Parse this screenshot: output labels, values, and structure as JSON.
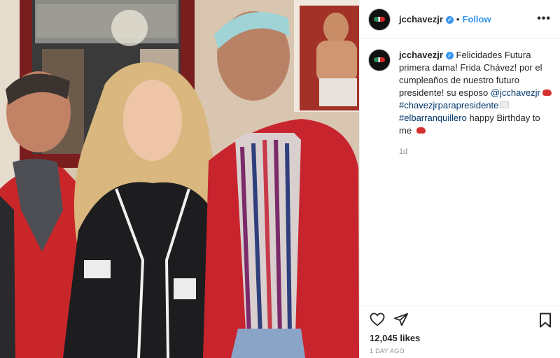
{
  "header": {
    "username": "jcchavezjr",
    "separator": "•",
    "follow_label": "Follow",
    "more_label": "•••"
  },
  "caption": {
    "username": "jcchavezjr",
    "text_1": "Felicidades Futura primera dama! Frida Chávez! por el cumpleaños de nuestro futuro presidente! su esposo",
    "mention": "@jcchavezjr",
    "hashtag_1": "#chavezjrparapresidente",
    "hashtag_2": "#elbarranquillero",
    "text_2": "happy Birthday to me",
    "time": "1d"
  },
  "footer": {
    "likes": "12,045 likes",
    "posted": "1 DAY AGO"
  },
  "icons": {
    "like": "heart-icon",
    "share": "paper-plane-icon",
    "save": "bookmark-icon",
    "verified": "verified-badge-icon",
    "more": "more-options-icon"
  },
  "colors": {
    "accent": "#3897f0",
    "text": "#262626",
    "muted": "#8e8e8e",
    "link": "#00376b"
  }
}
